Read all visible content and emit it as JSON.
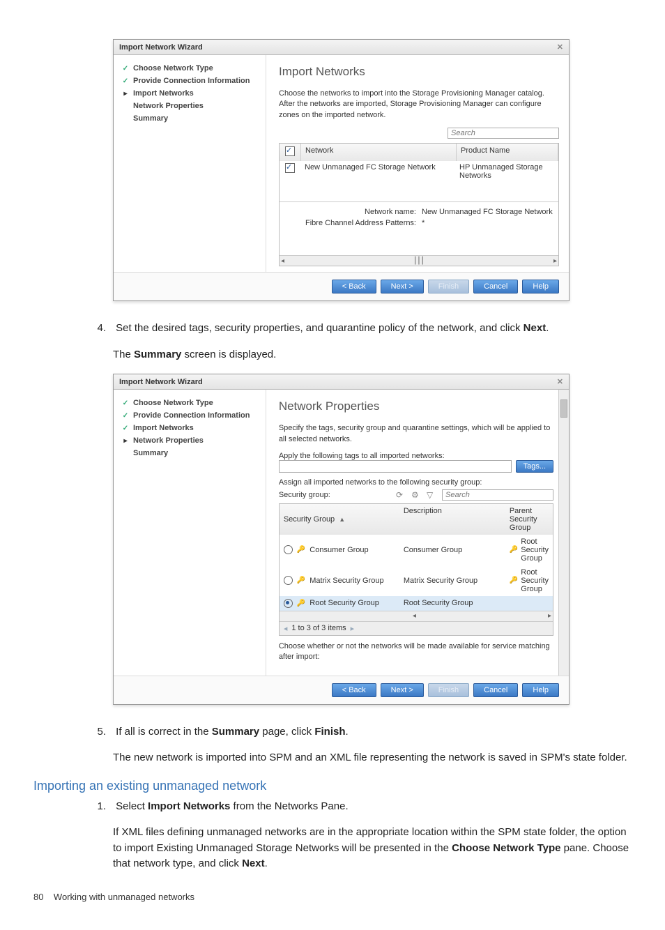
{
  "wizard1": {
    "title": "Import Network Wizard",
    "nav": {
      "choose": "Choose Network Type",
      "provide": "Provide Connection Information",
      "import": "Import Networks",
      "props": "Network Properties",
      "summary": "Summary"
    },
    "heading": "Import Networks",
    "desc": "Choose the networks to import into the Storage Provisioning Manager catalog. After the networks are imported, Storage Provisioning Manager can configure zones on the imported network.",
    "search_placeholder": "Search",
    "cols": {
      "network": "Network",
      "product": "Product Name"
    },
    "row": {
      "network": "New Unmanaged FC Storage Network",
      "product": "HP Unmanaged Storage Networks"
    },
    "details": {
      "name_lbl": "Network name:",
      "name_val": "New Unmanaged FC Storage Network",
      "fcap_lbl": "Fibre Channel Address Patterns:",
      "fcap_val": "*"
    },
    "buttons": {
      "back": "< Back",
      "next": "Next >",
      "finish": "Finish",
      "cancel": "Cancel",
      "help": "Help"
    }
  },
  "step4": {
    "num": "4.",
    "text_a": "Set the desired tags, security properties, and quarantine policy of the network, and click ",
    "bold_a": "Next",
    "text_b": ".",
    "line2_a": "The ",
    "line2_bold": "Summary",
    "line2_b": " screen is displayed."
  },
  "wizard2": {
    "title": "Import Network Wizard",
    "nav": {
      "choose": "Choose Network Type",
      "provide": "Provide Connection Information",
      "import": "Import Networks",
      "props": "Network Properties",
      "summary": "Summary"
    },
    "heading": "Network Properties",
    "desc": "Specify the tags, security group and quarantine settings, which will be applied to all selected networks.",
    "apply_tags": "Apply the following tags to all imported networks:",
    "tags_btn": "Tags...",
    "assign_lbl": "Assign all imported networks to the following security group:",
    "sg_lbl": "Security group:",
    "search_placeholder": "Search",
    "cols": {
      "sg": "Security Group",
      "desc": "Description",
      "parent": "Parent Security Group"
    },
    "rows": [
      {
        "name": "Consumer Group",
        "desc": "Consumer Group",
        "parent": "Root Security Group",
        "selected": false
      },
      {
        "name": "Matrix Security Group",
        "desc": "Matrix Security Group",
        "parent": "Root Security Group",
        "selected": false
      },
      {
        "name": "Root Security Group",
        "desc": "Root Security Group",
        "parent": "",
        "selected": true
      }
    ],
    "pager": "1 to 3 of 3 items",
    "choose_avail": "Choose whether or not the networks will be made available for service matching after import:",
    "buttons": {
      "back": "< Back",
      "next": "Next >",
      "finish": "Finish",
      "cancel": "Cancel",
      "help": "Help"
    }
  },
  "step5": {
    "num": "5.",
    "text_a": "If all is correct in the ",
    "bold_a": "Summary",
    "text_b": " page, click ",
    "bold_b": "Finish",
    "text_c": ".",
    "line2": "The new network is imported into SPM and an XML file representing the network is saved in SPM's state folder."
  },
  "section_heading": "Importing an existing unmanaged network",
  "step_s1": {
    "num": "1.",
    "text_a": "Select ",
    "bold_a": "Import Networks",
    "text_b": " from the Networks Pane."
  },
  "s1_para_a": "If XML files defining unmanaged networks are in the appropriate location within the SPM state folder, the option to import Existing Unmanaged Storage Networks will be presented in the ",
  "s1_para_bold": "Choose Network Type",
  "s1_para_b": " pane. Choose that network type, and click ",
  "s1_para_bold2": "Next",
  "s1_para_c": ".",
  "footer": {
    "page": "80",
    "title": "Working with unmanaged networks"
  }
}
